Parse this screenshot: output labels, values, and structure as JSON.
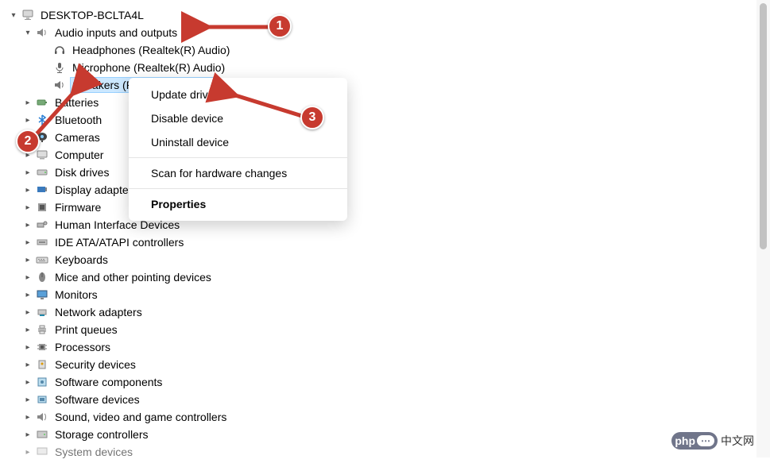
{
  "root": {
    "label": "DESKTOP-BCLTA4L"
  },
  "audio": {
    "label": "Audio inputs and outputs",
    "children": {
      "headphones": "Headphones (Realtek(R) Audio)",
      "microphone": "Microphone (Realtek(R) Audio)",
      "speakers": "Speakers (Realtek(R) Audio)"
    }
  },
  "categories": {
    "batteries": "Batteries",
    "bluetooth": "Bluetooth",
    "cameras": "Cameras",
    "computer": "Computer",
    "disk": "Disk drives",
    "display": "Display adapters",
    "firmware": "Firmware",
    "hid": "Human Interface Devices",
    "ide": "IDE ATA/ATAPI controllers",
    "keyboards": "Keyboards",
    "mice": "Mice and other pointing devices",
    "monitors": "Monitors",
    "network": "Network adapters",
    "printq": "Print queues",
    "processors": "Processors",
    "security": "Security devices",
    "swcomp": "Software components",
    "swdev": "Software devices",
    "sound": "Sound, video and game controllers",
    "storage": "Storage controllers",
    "system": "System devices"
  },
  "ctx": {
    "update": "Update driver",
    "disable": "Disable device",
    "uninstall": "Uninstall device",
    "scan": "Scan for hardware changes",
    "properties": "Properties"
  },
  "callouts": {
    "n1": "1",
    "n2": "2",
    "n3": "3"
  },
  "watermark": {
    "brand_a": "php",
    "brand_b": "中文网"
  }
}
